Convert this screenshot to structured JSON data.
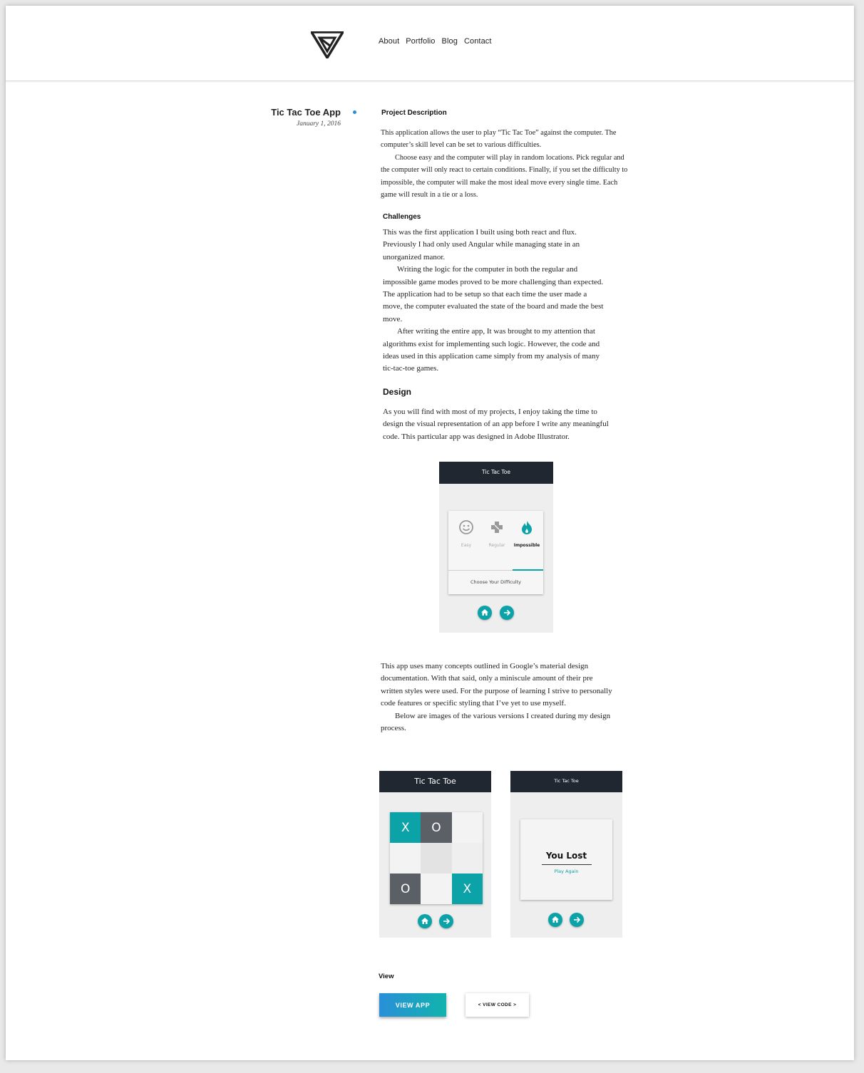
{
  "nav": {
    "items": [
      "About",
      "Portfolio",
      "Blog",
      "Contact"
    ]
  },
  "post": {
    "title": "Tic Tac Toe App",
    "date": "January 1, 2016"
  },
  "sections": {
    "description_heading": "Project Description",
    "description_lines": [
      "This application allows the user to play “Tic Tac Toe” against the computer. The",
      "computer’s skill level can be set to various difficulties.",
      "Choose easy and the computer will play in random locations. Pick regular and",
      "the computer will only react to certain conditions. Finally, if you set the difficulty to",
      "impossible, the computer will make the most ideal move every single time. Each",
      "game will result in a tie or a loss."
    ],
    "challenges_heading": "Challenges",
    "challenges_lines": [
      "This was the first application I built using both react and flux.",
      "Previously I had only used Angular while managing state in an",
      "unorganized manor.",
      "Writing the logic for the computer in both the regular and",
      "impossible game modes proved to be more challenging than expected.",
      "The application had to be setup so that each time the user made a",
      "move, the computer evaluated the state of the board and made the best",
      "move.",
      "After writing the entire app, It was brought to my attention that",
      "algorithms exist for implementing such logic. However, the code and",
      "ideas used in this application came simply from my analysis of many",
      "tic-tac-toe games."
    ],
    "design_heading": "Design",
    "design_lines": [
      "As you will find with most of my projects, I enjoy taking the time to",
      "design the visual representation of an app before I write any meaningful",
      "code. This particular app was designed in Adobe Illustrator."
    ],
    "material_lines": [
      "This app uses many concepts outlined in Google’s material design",
      "documentation. With that said, only a miniscule amount of their pre",
      "written styles were used. For the purpose of learning I strive to personally",
      "code features or specific styling that I’ve yet to use myself.",
      "Below are images of the various versions I created during my design",
      "process."
    ],
    "view_heading": "View"
  },
  "mockups": {
    "difficulty": {
      "title": "Tic Tac Toe",
      "options": [
        "Easy",
        "Regular",
        "Impossible"
      ],
      "selected": "Impossible",
      "prompt": "Choose Your Difficulty"
    },
    "board": {
      "title": "Tic Tac Toe",
      "cells": [
        "X",
        "O",
        "",
        "",
        "",
        "",
        "O",
        "",
        "X"
      ]
    },
    "result": {
      "title": "Tic Tac Toe",
      "message": "You Lost",
      "action": "Play Again"
    },
    "home_icon": "home-icon",
    "next_icon": "arrow-right-icon"
  },
  "buttons": {
    "view_app": "VIEW APP",
    "view_code": "< VIEW CODE >"
  },
  "colors": {
    "accent": "#0ba3a8",
    "dot": "#2b8fd6",
    "mock_bar": "#202731",
    "dark_cell": "#5b5f66"
  }
}
